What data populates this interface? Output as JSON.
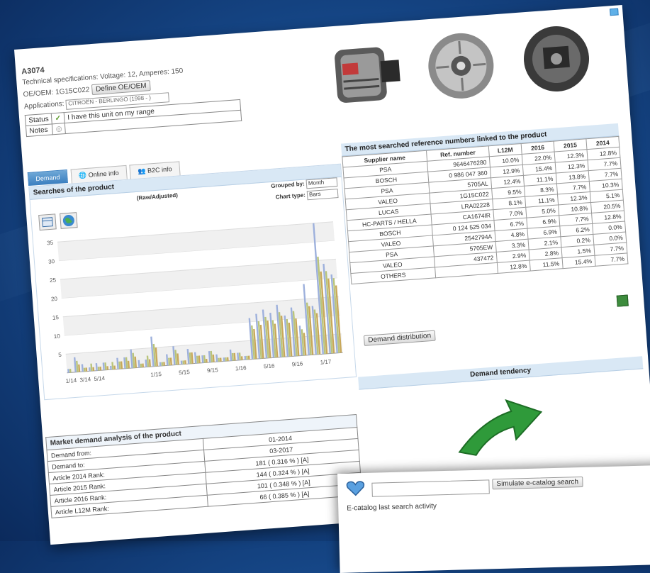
{
  "header": {
    "article": "A3074",
    "tech_specs": "Technical specifications: Voltage: 12, Amperes: 150",
    "oe_label": "OE/OEM: 1G15C022",
    "define_btn": "Define OE/OEM",
    "applications_label": "Applications:",
    "applications_value": "CITROËN - BERLINGO (1998 - )",
    "status_label": "Status",
    "status_text": "I have this unit on my range",
    "notes_label": "Notes"
  },
  "tabs": [
    "Demand",
    "Online info",
    "B2C info"
  ],
  "demand": {
    "title": "Searches of the product",
    "adjusted_label": "(Raw/Adjusted)",
    "grouped_label": "Grouped by:",
    "grouped_value": "Month",
    "chart_type_label": "Chart type:",
    "chart_type_value": "Bars"
  },
  "chart_data": {
    "type": "bar",
    "categories": [
      "1/14",
      "2/14",
      "3/14",
      "4/14",
      "5/14",
      "6/14",
      "7/14",
      "8/14",
      "9/14",
      "10/14",
      "11/14",
      "12/14",
      "1/15",
      "2/15",
      "3/15",
      "4/15",
      "5/15",
      "6/15",
      "7/15",
      "8/15",
      "9/15",
      "10/15",
      "11/15",
      "12/15",
      "1/16",
      "2/16",
      "3/16",
      "4/16",
      "5/16",
      "6/16",
      "7/16",
      "8/16",
      "9/16",
      "10/16",
      "11/16",
      "12/16",
      "1/17",
      "2/17",
      "3/17"
    ],
    "x_tick_labels": [
      "1/14",
      "3/14",
      "5/14",
      "1/15",
      "5/15",
      "9/15",
      "1/16",
      "5/16",
      "9/16",
      "1/17"
    ],
    "series": [
      {
        "values": [
          1,
          4,
          2,
          1,
          2,
          2,
          1,
          3,
          3,
          5,
          2,
          2,
          8,
          1,
          3,
          5,
          1,
          4,
          3,
          2,
          3,
          2,
          1,
          3,
          2,
          1,
          11,
          12,
          13,
          12,
          14,
          11,
          13,
          8,
          19,
          13,
          35,
          24,
          21
        ]
      },
      {
        "values": [
          1,
          3,
          1,
          2,
          1,
          2,
          2,
          2,
          3,
          4,
          1,
          3,
          6,
          1,
          2,
          4,
          1,
          3,
          2,
          2,
          3,
          1,
          1,
          2,
          2,
          1,
          9,
          10,
          11,
          10,
          12,
          10,
          12,
          7,
          14,
          12,
          26,
          22,
          20
        ]
      },
      {
        "values": [
          0,
          2,
          1,
          1,
          1,
          1,
          1,
          2,
          2,
          3,
          1,
          2,
          5,
          1,
          2,
          3,
          1,
          3,
          2,
          1,
          2,
          1,
          1,
          2,
          1,
          1,
          8,
          9,
          10,
          9,
          11,
          9,
          10,
          6,
          13,
          11,
          22,
          20,
          18
        ]
      }
    ],
    "ylim": [
      0,
      35
    ],
    "yticks": [
      5,
      10,
      15,
      20,
      25,
      30,
      35
    ],
    "colors": [
      "#9db0dc",
      "#b9c47a",
      "#c8a85a"
    ]
  },
  "references": {
    "title": "The most searched reference numbers linked to the product",
    "columns": [
      "Supplier name",
      "Ref. number",
      "L12M",
      "2016",
      "2015",
      "2014"
    ],
    "rows": [
      [
        "PSA",
        "9646476280",
        "10.0%",
        "22.0%",
        "12.3%",
        "12.8%"
      ],
      [
        "BOSCH",
        "0 986 047 360",
        "12.9%",
        "15.4%",
        "12.3%",
        "7.7%"
      ],
      [
        "PSA",
        "5705AL",
        "12.4%",
        "11.1%",
        "13.8%",
        "7.7%"
      ],
      [
        "VALEO",
        "1G15C022",
        "9.5%",
        "8.3%",
        "7.7%",
        "10.3%"
      ],
      [
        "LUCAS",
        "LRA02228",
        "8.1%",
        "11.1%",
        "12.3%",
        "5.1%"
      ],
      [
        "HC-PARTS / HELLA",
        "CA1674IR",
        "7.0%",
        "5.0%",
        "10.8%",
        "20.5%"
      ],
      [
        "BOSCH",
        "0 124 525 034",
        "6.7%",
        "6.9%",
        "7.7%",
        "12.8%"
      ],
      [
        "VALEO",
        "2542794A",
        "4.8%",
        "6.9%",
        "6.2%",
        "0.0%"
      ],
      [
        "PSA",
        "5705EW",
        "3.3%",
        "2.1%",
        "0.2%",
        "0.0%"
      ],
      [
        "VALEO",
        "437472",
        "2.9%",
        "2.8%",
        "1.5%",
        "7.7%"
      ],
      [
        "OTHERS",
        "",
        "12.8%",
        "11.5%",
        "15.4%",
        "7.7%"
      ]
    ],
    "distribution_btn": "Demand distribution"
  },
  "tendency": {
    "title": "Demand tendency"
  },
  "market": {
    "title": "Market demand analysis of the product",
    "rows": [
      [
        "Demand from:",
        "01-2014"
      ],
      [
        "Demand to:",
        "03-2017"
      ],
      [
        "Article 2014 Rank:",
        "181 ( 0.316 % ) [A]"
      ],
      [
        "Article 2015 Rank:",
        "144 ( 0.324 % ) [A]"
      ],
      [
        "Article 2016 Rank:",
        "101 ( 0.348 % ) [A]"
      ],
      [
        "Article L12M Rank:",
        "66 ( 0.385 % ) [A]"
      ]
    ]
  },
  "ecatalog": {
    "simulate_btn": "Simulate e-catalog search",
    "last_activity": "E-catalog last search activity"
  }
}
